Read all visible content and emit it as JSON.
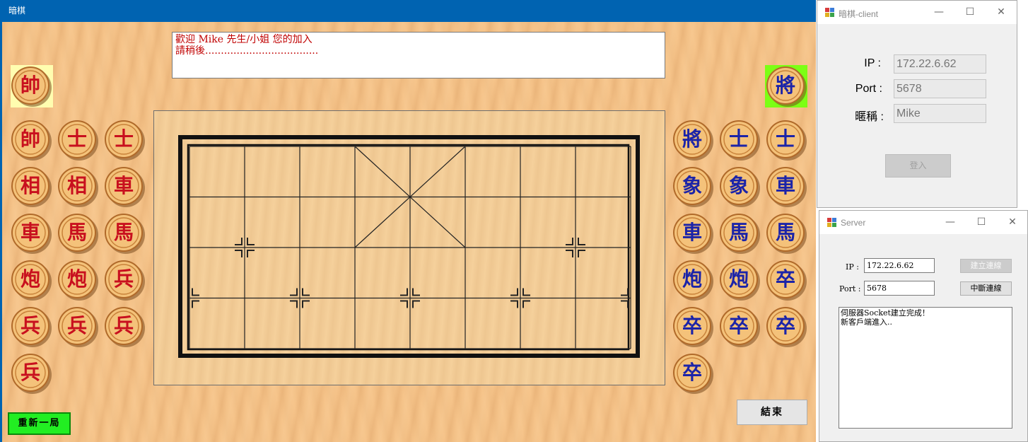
{
  "game": {
    "title": "暗棋",
    "message_lines": [
      "歡迎 Mike 先生/小姐 您的加入",
      "請稍後...................................."
    ],
    "restart_label": "重新一局",
    "end_label": "結束",
    "current_red": "帥",
    "current_blue": "將",
    "red_pieces": [
      "帥",
      "士",
      "士",
      "相",
      "相",
      "車",
      "車",
      "馬",
      "馬",
      "炮",
      "炮",
      "兵",
      "兵",
      "兵",
      "兵",
      "兵"
    ],
    "blue_pieces": [
      "將",
      "士",
      "士",
      "象",
      "象",
      "車",
      "車",
      "馬",
      "馬",
      "炮",
      "炮",
      "卒",
      "卒",
      "卒",
      "卒",
      "卒"
    ],
    "colors": {
      "red_text": "#c8101e",
      "blue_text": "#1c24a8",
      "piece_face": "#f4c27a",
      "titlebar": "#0063b1",
      "restart_bg": "#22ee22",
      "current_red_highlight": "#fffdb0",
      "current_blue_highlight": "#7cff14"
    }
  },
  "client": {
    "title": "暗棋-client",
    "ip_label": "IP :",
    "ip_value": "172.22.6.62",
    "port_label": "Port :",
    "port_value": "5678",
    "nick_label": "暱稱 :",
    "nick_value": "Mike",
    "login_label": "登入"
  },
  "server": {
    "title": "Server",
    "ip_label": "IP :",
    "ip_value": "172.22.6.62",
    "port_label": "Port :",
    "port_value": "5678",
    "connect_label": "建立連線",
    "disconnect_label": "中斷連線",
    "log_lines": [
      "伺服器Socket建立完成！",
      "新客戶端進入.."
    ]
  }
}
